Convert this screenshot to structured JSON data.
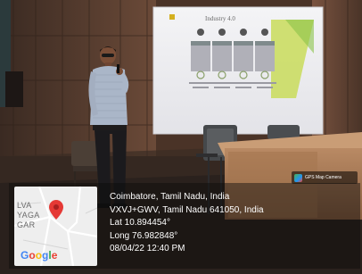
{
  "slide": {
    "title": "Industry 4.0"
  },
  "gps_app_badge": "GPS Map Camera",
  "map": {
    "place_lines": [
      "LVA",
      "YAGA",
      "GAR"
    ],
    "google_letters": [
      {
        "ch": "G",
        "color": "#4285f4"
      },
      {
        "ch": "o",
        "color": "#ea4335"
      },
      {
        "ch": "o",
        "color": "#fbbc05"
      },
      {
        "ch": "g",
        "color": "#4285f4"
      },
      {
        "ch": "l",
        "color": "#34a853"
      },
      {
        "ch": "e",
        "color": "#ea4335"
      }
    ],
    "pin_color": "#e53935"
  },
  "location": {
    "city": "Coimbatore, Tamil Nadu, India",
    "address": "VXVJ+GWV, Tamil Nadu 641050, India",
    "lat": "Lat 10.894454°",
    "long": "Long 76.982848°",
    "datetime": "08/04/22 12:40 PM"
  }
}
